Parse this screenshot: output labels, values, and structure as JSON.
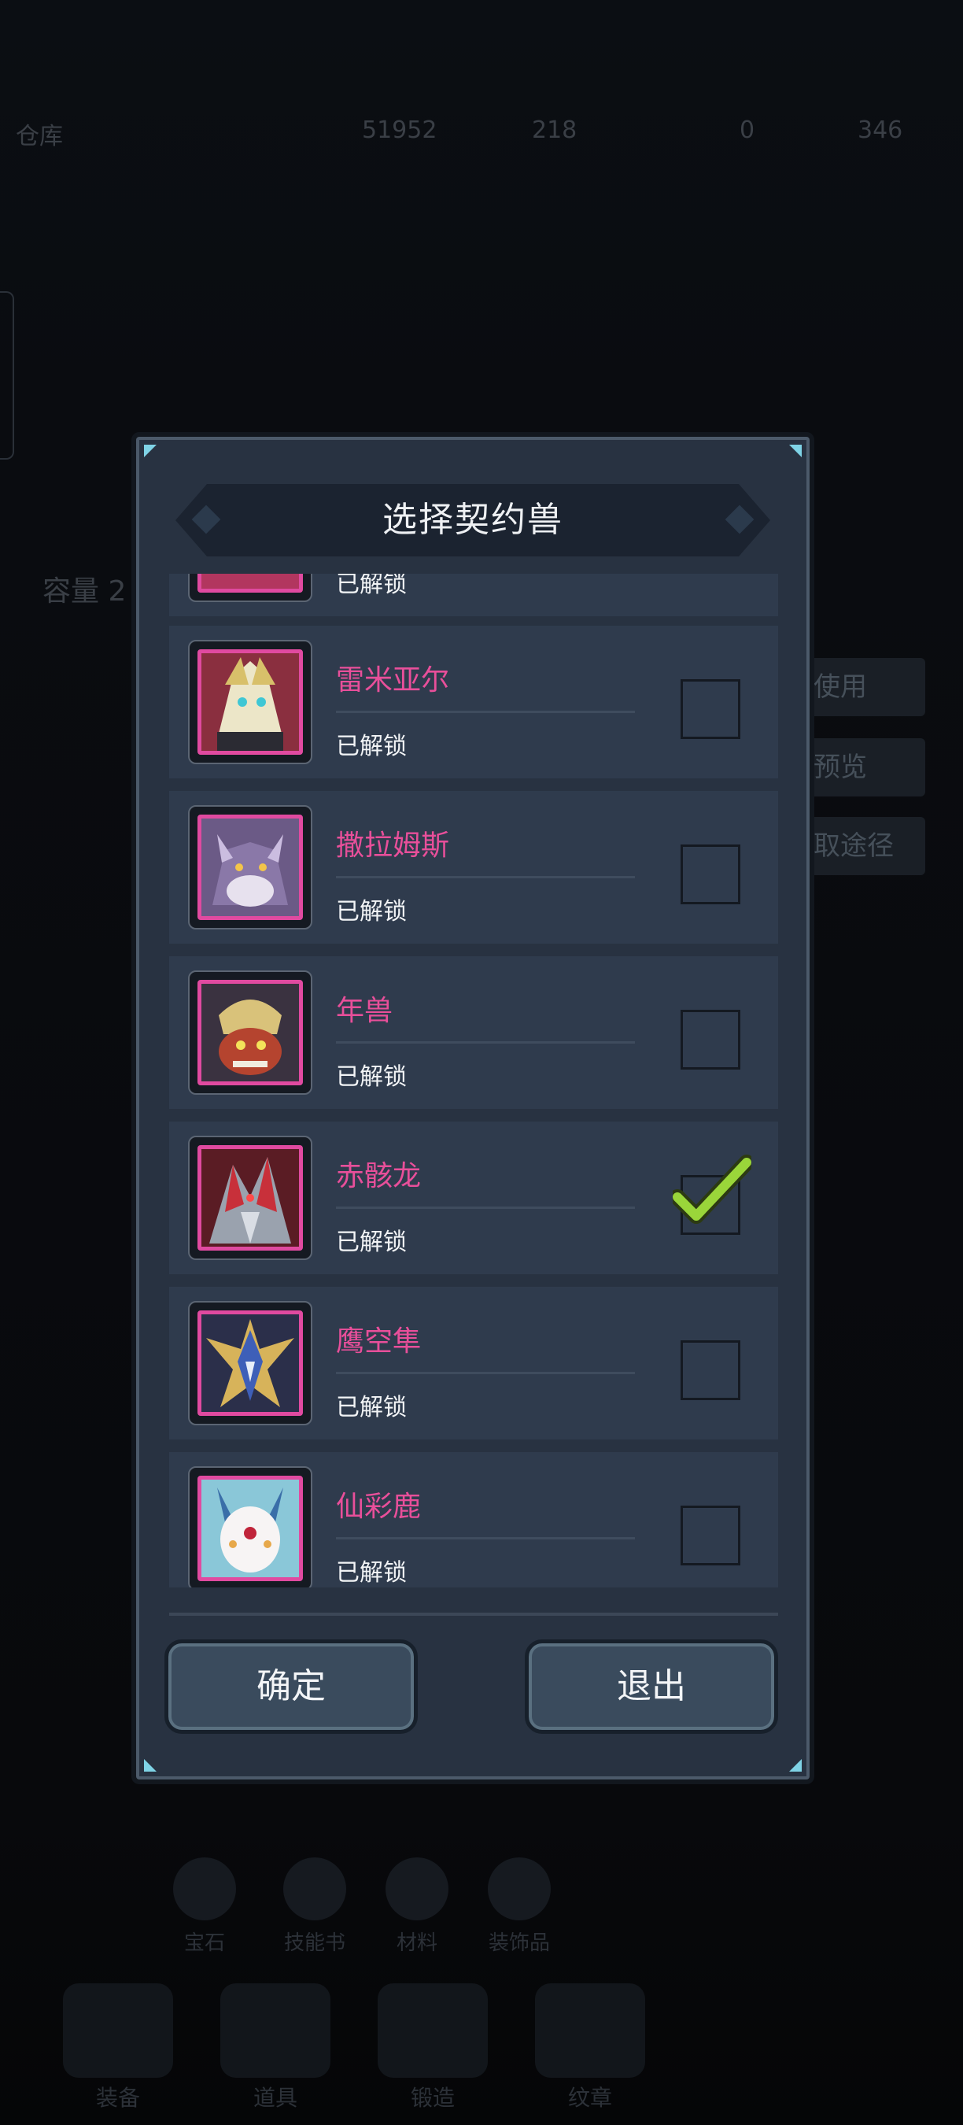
{
  "background": {
    "topbar": {
      "warehouse_label": "仓库",
      "gold": "51952",
      "energy": "218",
      "other": "0",
      "gems": "346"
    },
    "capacity_label": "容量 2",
    "buttons": [
      "使用",
      "预览",
      "取途径"
    ],
    "tabs": [
      "宝石",
      "技能书",
      "材料",
      "装饰品"
    ],
    "nav": [
      "装备",
      "道具",
      "锻造",
      "纹章"
    ]
  },
  "dialog": {
    "title": "选择契约兽",
    "partial_row_status": "已解锁",
    "beasts": [
      {
        "name": "雷米亚尔",
        "status": "已解锁",
        "selected": false,
        "icon": "white-dragon-avatar"
      },
      {
        "name": "撒拉姆斯",
        "status": "已解锁",
        "selected": false,
        "icon": "purple-beast-avatar"
      },
      {
        "name": "年兽",
        "status": "已解锁",
        "selected": false,
        "icon": "nian-beast-avatar"
      },
      {
        "name": "赤骸龙",
        "status": "已解锁",
        "selected": true,
        "icon": "red-bone-dragon-avatar"
      },
      {
        "name": "鹰空隼",
        "status": "已解锁",
        "selected": false,
        "icon": "hawk-avatar"
      },
      {
        "name": "仙彩鹿",
        "status": "已解锁",
        "selected": false,
        "icon": "fairy-deer-avatar"
      }
    ],
    "confirm_label": "确定",
    "exit_label": "退出"
  },
  "colors": {
    "name_pink": "#e84f9a",
    "check_green": "#9ad63a",
    "panel": "#283241",
    "row": "#2f3b4d"
  }
}
